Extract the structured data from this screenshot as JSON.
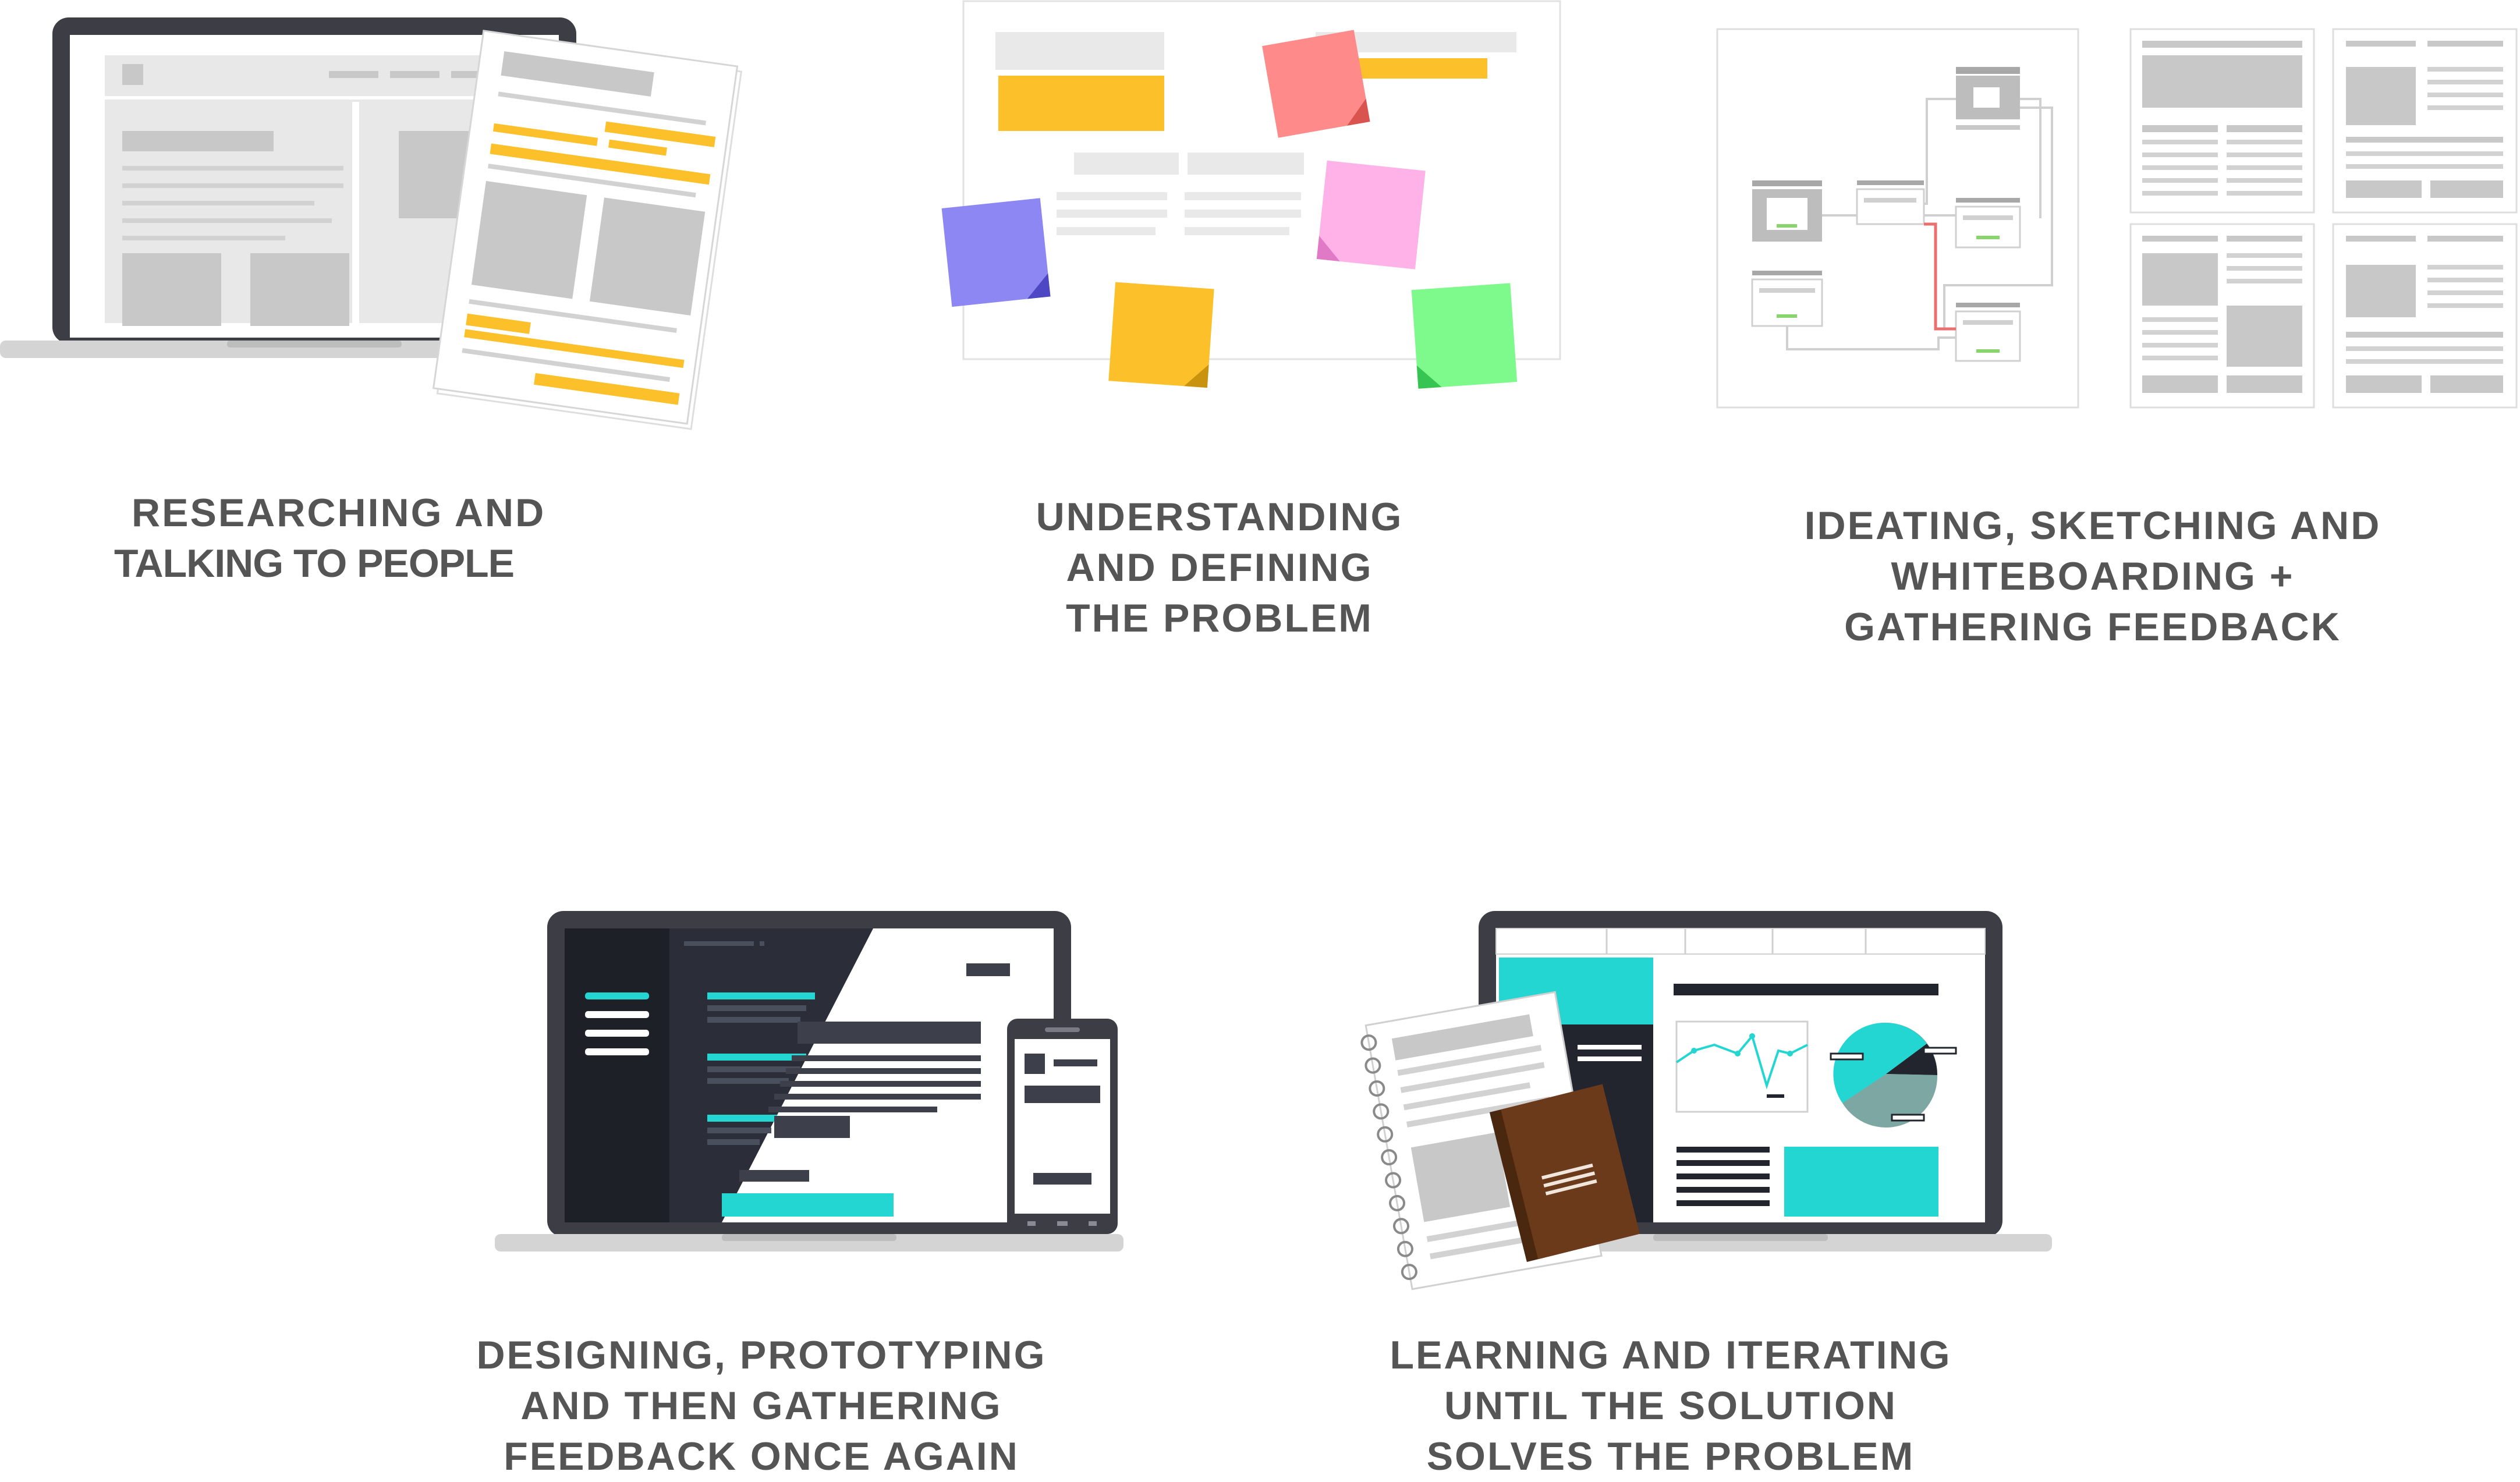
{
  "steps": [
    {
      "id": "research",
      "lines": [
        "RESEARCHING AND",
        "TALKING TO PEOPLE"
      ]
    },
    {
      "id": "define",
      "lines": [
        "UNDERSTANDING",
        "AND DEFINING",
        "THE PROBLEM"
      ]
    },
    {
      "id": "ideate",
      "lines": [
        "IDEATING, SKETCHING AND",
        "WHITEBOARDING +",
        "GATHERING FEEDBACK"
      ]
    },
    {
      "id": "design",
      "lines": [
        "DESIGNING, PROTOTYPING",
        "AND THEN GATHERING",
        "FEEDBACK ONCE AGAIN"
      ]
    },
    {
      "id": "iterate",
      "lines": [
        "LEARNING AND ITERATING",
        "UNTIL THE SOLUTION",
        "SOLVES THE PROBLEM"
      ]
    }
  ],
  "colors": {
    "caption": "#555555",
    "device_frame": "#3d3d46",
    "device_base": "#d4d4d4",
    "placeholder": "#c8c8c8",
    "highlight": "#fcc02a",
    "note_red": "#fe8a8a",
    "note_purple": "#8c87f2",
    "note_pink": "#feb2e7",
    "note_green": "#7ef98b",
    "teal": "#24d6d1",
    "dark_panel": "#23252e",
    "journal": "#6b3a1a",
    "connector_red": "#ea6f6f"
  }
}
